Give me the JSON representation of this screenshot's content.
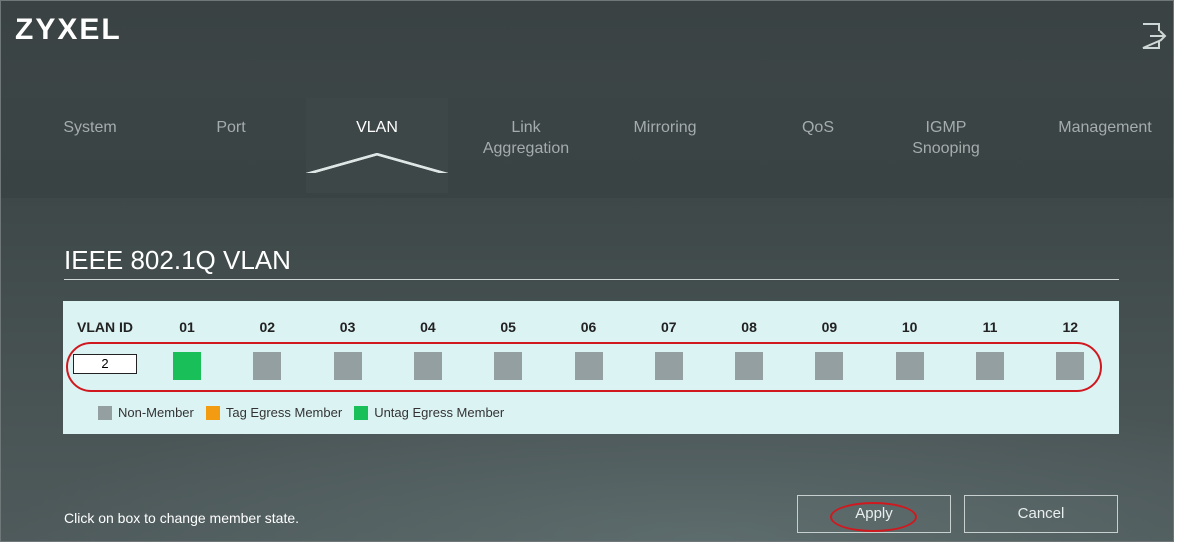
{
  "brand": {
    "logo_text": "ZYXEL"
  },
  "header": {
    "logout_icon": "logout-icon"
  },
  "tabs": [
    {
      "label": "System",
      "active": false
    },
    {
      "label": "Port",
      "active": false
    },
    {
      "label": "VLAN",
      "active": true
    },
    {
      "label": "Link Aggregation",
      "active": false
    },
    {
      "label": "Mirroring",
      "active": false
    },
    {
      "label": "QoS",
      "active": false
    },
    {
      "label": "IGMP Snooping",
      "active": false
    },
    {
      "label": "Management",
      "active": false
    }
  ],
  "section": {
    "title": "IEEE 802.1Q VLAN"
  },
  "vlan_table": {
    "id_header": "VLAN ID",
    "ports": [
      "01",
      "02",
      "03",
      "04",
      "05",
      "06",
      "07",
      "08",
      "09",
      "10",
      "11",
      "12"
    ],
    "vlan_id_value": "2",
    "port_states": [
      "untag",
      "non",
      "non",
      "non",
      "non",
      "non",
      "non",
      "non",
      "non",
      "non",
      "non",
      "non"
    ]
  },
  "legend": [
    {
      "label": "Non-Member",
      "color": "#949fa1"
    },
    {
      "label": "Tag Egress Member",
      "color": "#f39c12"
    },
    {
      "label": "Untag Egress Member",
      "color": "#19bf58"
    }
  ],
  "footer": {
    "hint": "Click on box to change member state.",
    "apply_label": "Apply",
    "cancel_label": "Cancel"
  },
  "annotations": {
    "highlight_color": "#d0191f"
  }
}
